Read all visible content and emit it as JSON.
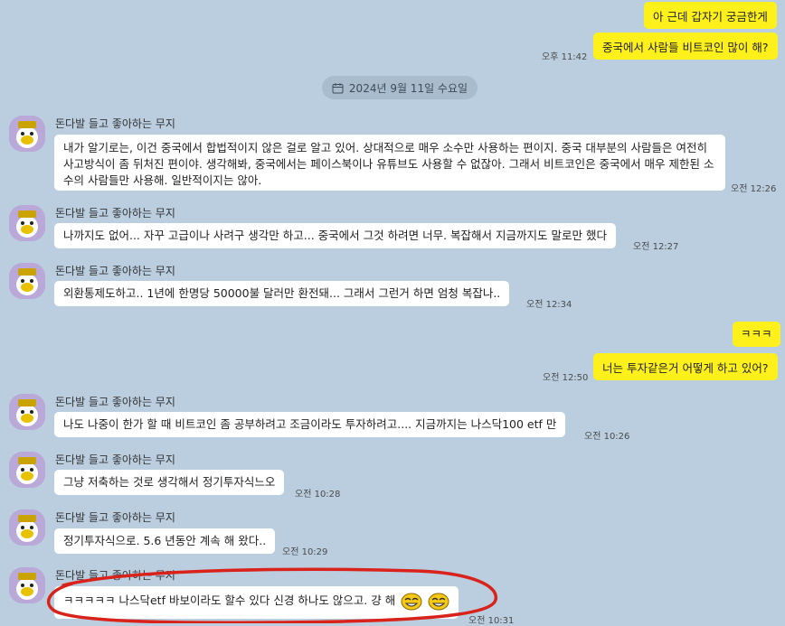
{
  "chat": {
    "date_divider": "2024년 9월 11일 수요일",
    "sender_name": "돈다발 들고 좋아하는 무지",
    "messages": [
      {
        "text": "아 근데 갑자기 궁금한게",
        "time": ""
      },
      {
        "text": "중국에서 사람들 비트코인 많이 해?",
        "time": "오후 11:42"
      },
      {
        "text": "내가 알기로는, 이건 중국에서 합법적이지 않은 걸로 알고 있어. 상대적으로 매우 소수만 사용하는 편이지. 중국 대부분의 사람들은 여전히 사고방식이 좀 뒤처진 편이야. 생각해봐, 중국에서는 페이스북이나 유튜브도 사용할 수 없잖아. 그래서 비트코인은 중국에서 매우 제한된 소수의 사람들만 사용해. 일반적이지는 않아.",
        "time": "오전 12:26"
      },
      {
        "text": "나까지도 없어... 자꾸 고급이나 사려구 생각만 하고... 중국에서 그것 하려면 너무. 복잡해서 지금까지도 말로만 했다",
        "time": "오전 12:27"
      },
      {
        "text": "외환통제도하고.. 1년에 한명당 50000불 달러만 환전돼... 그래서 그런거 하면 엄청 복잡나..",
        "time": "오전 12:34"
      },
      {
        "text": "ㅋㅋㅋ",
        "time": ""
      },
      {
        "text": "너는 투자같은거 어떻게 하고 있어?",
        "time": "오전 12:50"
      },
      {
        "text": "나도 나중이 한가 할 때 비트코인 좀 공부하려고 조금이라도 투자하려고....   지금까지는 나스닥100 etf 만",
        "time": "오전 10:26"
      },
      {
        "text": "그냥 저축하는 것로 생각해서 정기투자식느오",
        "time": "오전 10:28"
      },
      {
        "text": "정기투자식으로.  5.6 년동안 계속 해 왔다..",
        "time": "오전 10:29"
      },
      {
        "text": "ㅋㅋㅋㅋㅋ 나스닥etf 바보이라도 할수 있다 신경 하나도 않으고. 걍  해",
        "time": "오전 10:31"
      }
    ]
  },
  "colors": {
    "background": "#bacee0",
    "my_bubble": "#fef01b",
    "their_bubble": "#ffffff",
    "annotation_circle": "#d9221a"
  },
  "icons": [
    "calendar-icon",
    "avatar-muji-icon",
    "laughing-emoticon-icon"
  ]
}
